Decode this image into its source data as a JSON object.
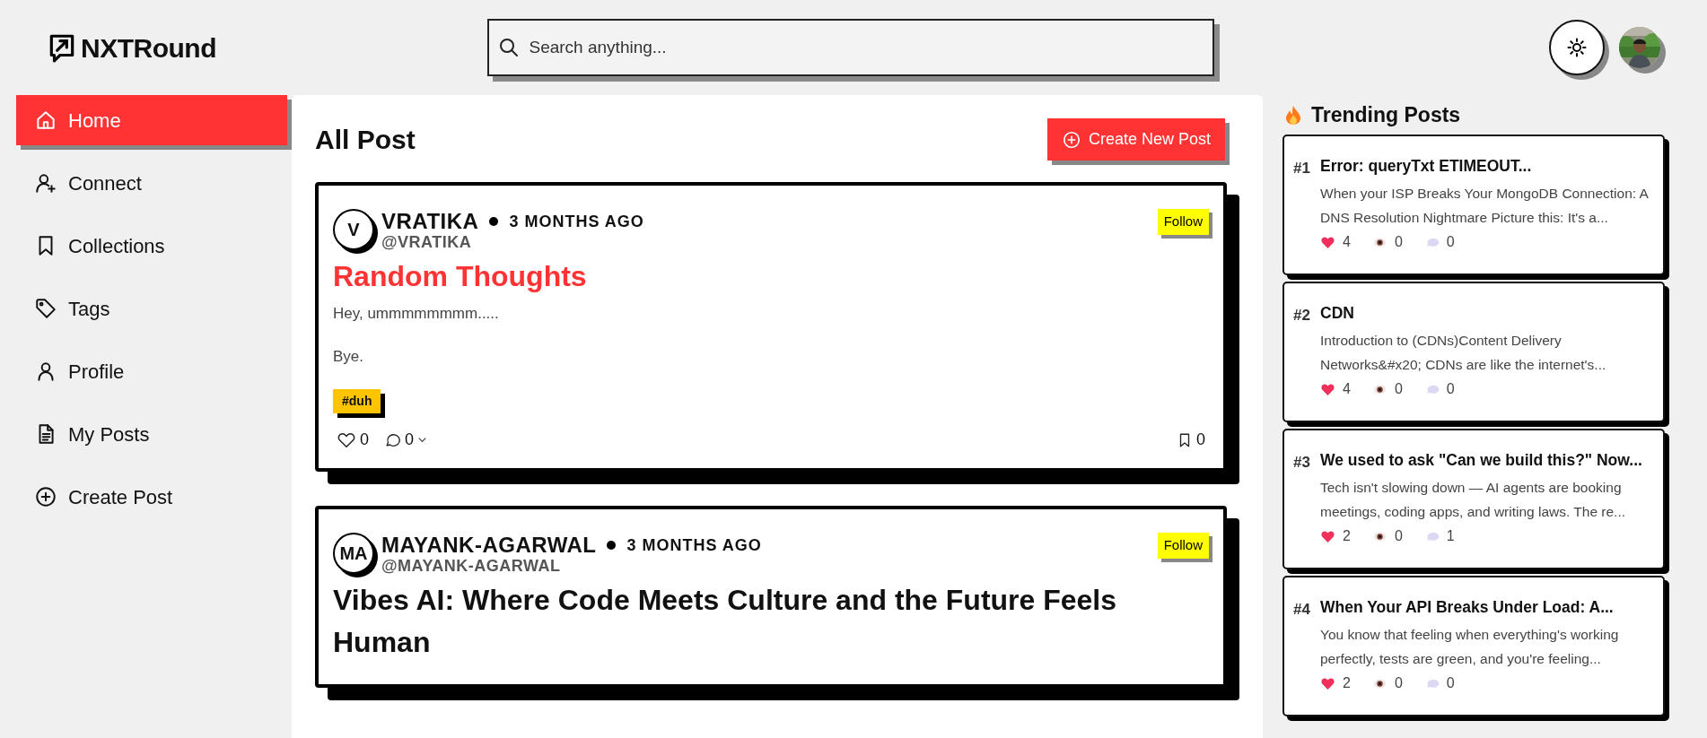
{
  "brand": {
    "name": "NXTRound"
  },
  "search": {
    "placeholder": "Search anything..."
  },
  "sidebar": {
    "items": [
      {
        "label": "Home",
        "selected": true
      },
      {
        "label": "Connect",
        "selected": false
      },
      {
        "label": "Collections",
        "selected": false
      },
      {
        "label": "Tags",
        "selected": false
      },
      {
        "label": "Profile",
        "selected": false
      },
      {
        "label": "My Posts",
        "selected": false
      },
      {
        "label": "Create Post",
        "selected": false
      }
    ]
  },
  "feed": {
    "title": "All Post",
    "create_button": "Create New Post",
    "posts": [
      {
        "initials": "V",
        "author": "VRATIKA",
        "time": "3 MONTHS AGO",
        "handle": "@VRATIKA",
        "follow": "Follow",
        "title": "Random Thoughts",
        "highlighted": true,
        "paragraphs": [
          "Hey, ummmmmmmm.....",
          "Bye."
        ],
        "tags": [
          "#duh"
        ],
        "likes": "0",
        "comments": "0",
        "saves": "0"
      },
      {
        "initials": "MA",
        "author": "MAYANK-AGARWAL",
        "time": "3 MONTHS AGO",
        "handle": "@MAYANK-AGARWAL",
        "follow": "Follow",
        "title": "Vibes AI: Where Code Meets Culture and the Future Feels Human",
        "highlighted": false
      }
    ]
  },
  "trending": {
    "title": "Trending Posts",
    "posts": [
      {
        "rank": "#1",
        "title": "Error: queryTxt ETIMEOUT...",
        "excerpt": "When your ISP Breaks Your MongoDB Connection: A DNS Resolution Nightmare Picture this: It's a...",
        "likes": "4",
        "views": "0",
        "comments": "0"
      },
      {
        "rank": "#2",
        "title": "CDN",
        "excerpt": "Introduction to (CDNs)Content Delivery Networks&#x20; CDNs are like the internet's...",
        "likes": "4",
        "views": "0",
        "comments": "0"
      },
      {
        "rank": "#3",
        "title": "We used to ask \"Can we build this?\" Now...",
        "excerpt": "Tech isn't slowing down — AI agents are booking meetings, coding apps, and writing laws. The re...",
        "likes": "2",
        "views": "0",
        "comments": "1"
      },
      {
        "rank": "#4",
        "title": "When Your API Breaks Under Load: A...",
        "excerpt": "You know that feeling when everything's working perfectly, tests are green, and you're feeling...",
        "likes": "2",
        "views": "0",
        "comments": "0"
      }
    ]
  }
}
